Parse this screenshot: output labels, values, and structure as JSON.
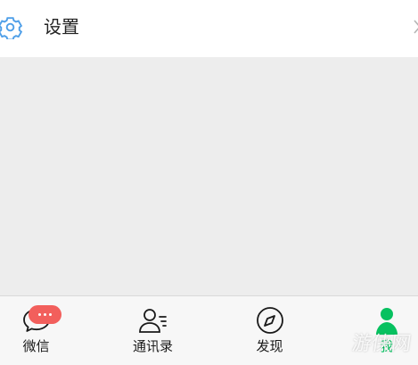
{
  "settings": {
    "label": "设置",
    "icon": "gear-icon",
    "chevron": "chevron-right-icon",
    "icon_color": "#4f9fe8"
  },
  "tabbar": {
    "badge_icon": "ellipsis-icon",
    "badge_color": "#f25f5c",
    "active_color": "#07c160",
    "items": [
      {
        "label": "微信",
        "icon": "chat-bubble-icon",
        "active": false
      },
      {
        "label": "通讯录",
        "icon": "contacts-icon",
        "active": false
      },
      {
        "label": "发现",
        "icon": "compass-icon",
        "active": false
      },
      {
        "label": "我",
        "icon": "person-icon",
        "active": true
      }
    ]
  },
  "watermark": {
    "text": "游侠网"
  }
}
